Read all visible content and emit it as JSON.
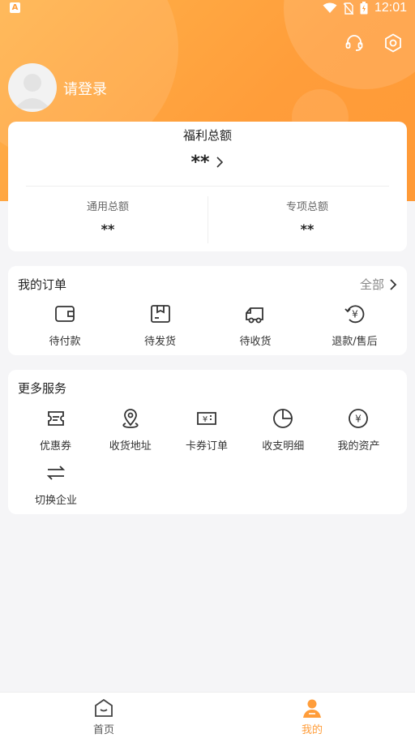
{
  "status": {
    "left_badge": "A",
    "time": "12:01"
  },
  "header": {
    "login_text": "请登录",
    "icons": [
      "headset-icon",
      "settings-icon"
    ]
  },
  "welfare": {
    "title": "福利总额",
    "amount": "**",
    "general_label": "通用总额",
    "general_value": "**",
    "special_label": "专项总额",
    "special_value": "**"
  },
  "orders": {
    "title": "我的订单",
    "all_label": "全部",
    "items": [
      {
        "label": "待付款",
        "icon": "wallet-icon"
      },
      {
        "label": "待发货",
        "icon": "package-icon"
      },
      {
        "label": "待收货",
        "icon": "truck-icon"
      },
      {
        "label": "退款/售后",
        "icon": "refund-icon"
      }
    ]
  },
  "services": {
    "title": "更多服务",
    "items": [
      {
        "label": "优惠券",
        "icon": "coupon-icon"
      },
      {
        "label": "收货地址",
        "icon": "location-icon"
      },
      {
        "label": "卡券订单",
        "icon": "card-voucher-icon"
      },
      {
        "label": "收支明细",
        "icon": "pie-chart-icon"
      },
      {
        "label": "我的资产",
        "icon": "yen-circle-icon"
      },
      {
        "label": "切换企业",
        "icon": "switch-icon"
      }
    ]
  },
  "tabbar": {
    "home_label": "首页",
    "mine_label": "我的"
  },
  "colors": {
    "accent": "#ff9d3a",
    "background": "#f5f5f7"
  }
}
